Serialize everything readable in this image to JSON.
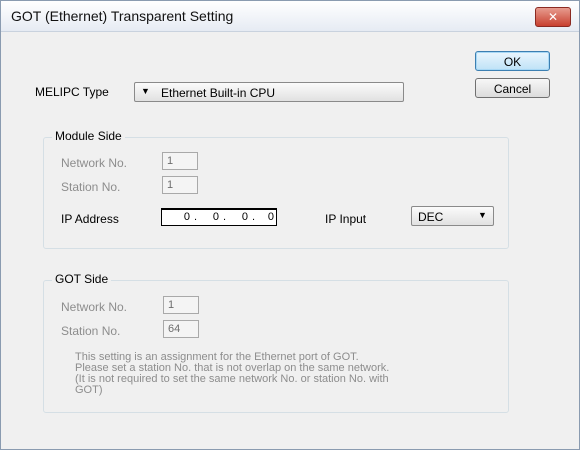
{
  "window": {
    "title": "GOT (Ethernet) Transparent Setting",
    "close_glyph": "✕"
  },
  "buttons": {
    "ok": "OK",
    "cancel": "Cancel"
  },
  "melipc": {
    "label": "MELIPC Type",
    "value": "Ethernet Built-in CPU",
    "arrow": "▼"
  },
  "module_side": {
    "title": "Module Side",
    "network_label": "Network No.",
    "network_value": "1",
    "station_label": "Station No.",
    "station_value": "1",
    "ip_label": "IP Address",
    "ip": [
      "0",
      "0",
      "0",
      "0"
    ],
    "ip_input_label": "IP Input",
    "ip_input_value": "DEC",
    "ip_input_arrow": "▼"
  },
  "got_side": {
    "title": "GOT Side",
    "network_label": "Network No.",
    "network_value": "1",
    "station_label": "Station No.",
    "station_value": "64",
    "note_lines": [
      "This setting is an assignment for the Ethernet port of GOT.",
      "Please set a station No. that is not overlap on the same network.",
      "(It is not required to set the same network No. or station No. with",
      "GOT)"
    ]
  }
}
